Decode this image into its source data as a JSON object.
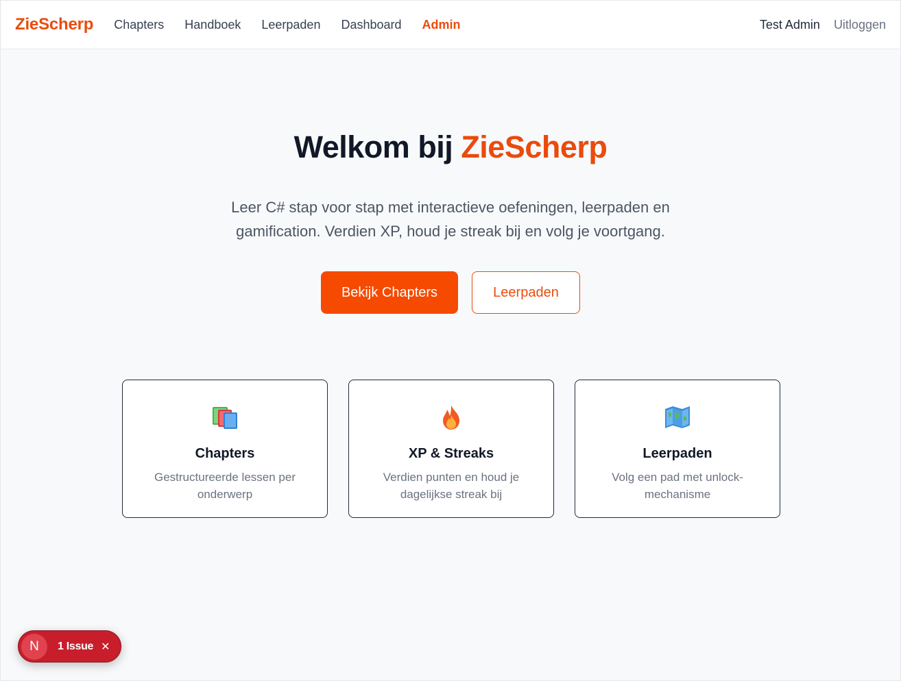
{
  "nav": {
    "brand": "ZieScherp",
    "links": [
      "Chapters",
      "Handboek",
      "Leerpaden",
      "Dashboard",
      "Admin"
    ],
    "active": "Admin",
    "user": "Test Admin",
    "logout": "Uitloggen"
  },
  "hero": {
    "title_prefix": "Welkom bij ",
    "title_accent": "ZieScherp",
    "subtitle": "Leer C# stap voor stap met interactieve oefeningen, leerpaden en gamification. Verdien XP, houd je streak bij en volg je voortgang.",
    "primary_button": "Bekijk Chapters",
    "secondary_button": "Leerpaden"
  },
  "features": [
    {
      "icon": "books-icon",
      "title": "Chapters",
      "description": "Gestructureerde lessen per onderwerp"
    },
    {
      "icon": "fire-icon",
      "title": "XP & Streaks",
      "description": "Verdien punten en houd je dagelijkse streak bij"
    },
    {
      "icon": "map-icon",
      "title": "Leerpaden",
      "description": "Volg een pad met unlock-mechanisme"
    }
  ],
  "issue_badge": {
    "logo": "N",
    "label": "1 Issue",
    "close_symbol": "✕"
  },
  "colors": {
    "accent": "#ea4b0c",
    "primary_button": "#f54a00",
    "issue_badge": "#c81e2b"
  }
}
